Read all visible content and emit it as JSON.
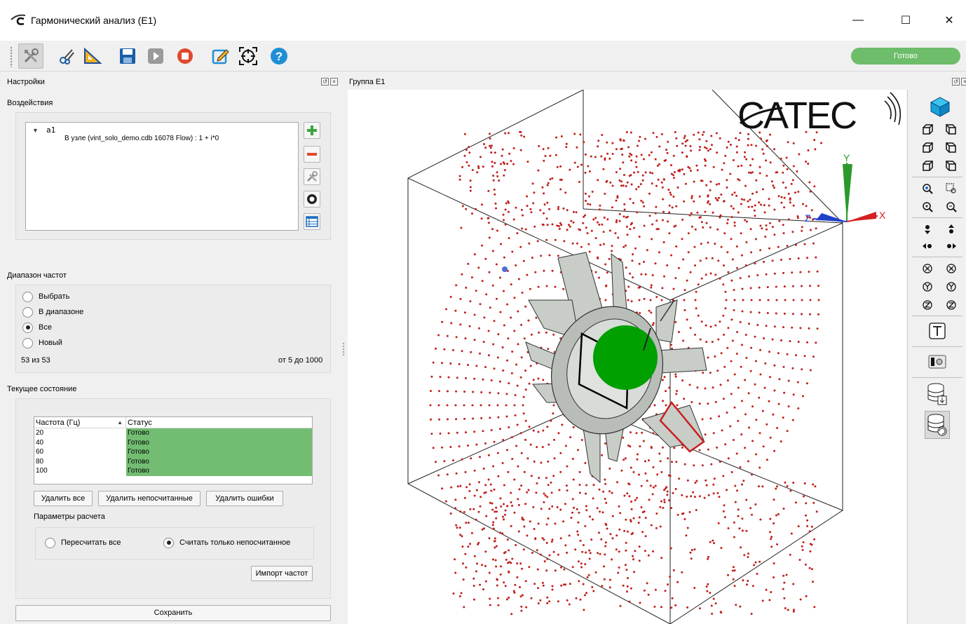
{
  "window": {
    "title": "Гармонический анализ (E1)",
    "controls": [
      "minimize-icon",
      "maximize-icon",
      "close-icon"
    ]
  },
  "toolbar": {
    "icons": [
      "settings-tools-icon",
      "scissors-icon",
      "ruler-triangle-icon",
      "save-icon",
      "play-icon",
      "stop-icon",
      "edit-note-icon",
      "target-icon",
      "help-icon"
    ],
    "status": "Готово",
    "status_color": "#6dbd6a"
  },
  "left_panel": {
    "title": "Настройки",
    "loads": {
      "label": "Воздействия",
      "items": [
        {
          "name": "a1",
          "description": "В узле (vint_solo_demo.cdb 16078 Flow) : 1 + i*0"
        }
      ],
      "buttons": [
        "add-icon",
        "remove-icon",
        "edit-tools-icon",
        "ring-icon",
        "table-icon"
      ]
    },
    "freq_range": {
      "label": "Диапазон частот",
      "options": [
        {
          "label": "Выбрать",
          "checked": false
        },
        {
          "label": "В диапазоне",
          "checked": false
        },
        {
          "label": "Все",
          "checked": true
        },
        {
          "label": "Новый",
          "checked": false
        }
      ],
      "count": "53 из 53",
      "range": "от 5 до 1000"
    },
    "current_state": {
      "label": "Текущее состояние",
      "table": {
        "headers": [
          "Частота (Гц)",
          "Статус"
        ],
        "rows": [
          [
            "20",
            "Готово"
          ],
          [
            "40",
            "Готово"
          ],
          [
            "60",
            "Готово"
          ],
          [
            "80",
            "Готово"
          ],
          [
            "100",
            "Готово"
          ]
        ]
      },
      "buttons": {
        "delete_all": "Удалить все",
        "delete_uncalc": "Удалить непосчитанные",
        "delete_errors": "Удалить ошибки"
      },
      "calc_params": {
        "label": "Параметры расчета",
        "options": [
          {
            "label": "Пересчитать все",
            "checked": false
          },
          {
            "label": "Считать только непосчитанное",
            "checked": true
          }
        ]
      },
      "import_button": "Импорт частот"
    },
    "save_button": "Сохранить"
  },
  "viewport": {
    "title": "Группа E1",
    "logo": "CATEC",
    "axes": [
      "X",
      "Y",
      "Z"
    ],
    "highlight_color": "#00a000",
    "points_color": "#c0201c"
  },
  "right_tools": {
    "icons": [
      "iso-view-icon",
      "front-view-icon",
      "back-view-icon",
      "left-view-icon",
      "right-view-icon",
      "top-view-icon",
      "bottom-view-icon",
      "zoom-fit-icon",
      "zoom-region-icon",
      "zoom-in-icon",
      "zoom-out-icon",
      "pan-down-icon",
      "pan-up-icon",
      "pan-left-icon",
      "pan-right-icon",
      "rotate-x-neg-icon",
      "rotate-x-pos-icon",
      "rotate-y-neg-icon",
      "rotate-y-pos-icon",
      "rotate-z-neg-icon",
      "rotate-z-pos-icon",
      "text-label-icon",
      "screenshot-icon",
      "db-export-icon",
      "db-refresh-icon"
    ]
  }
}
